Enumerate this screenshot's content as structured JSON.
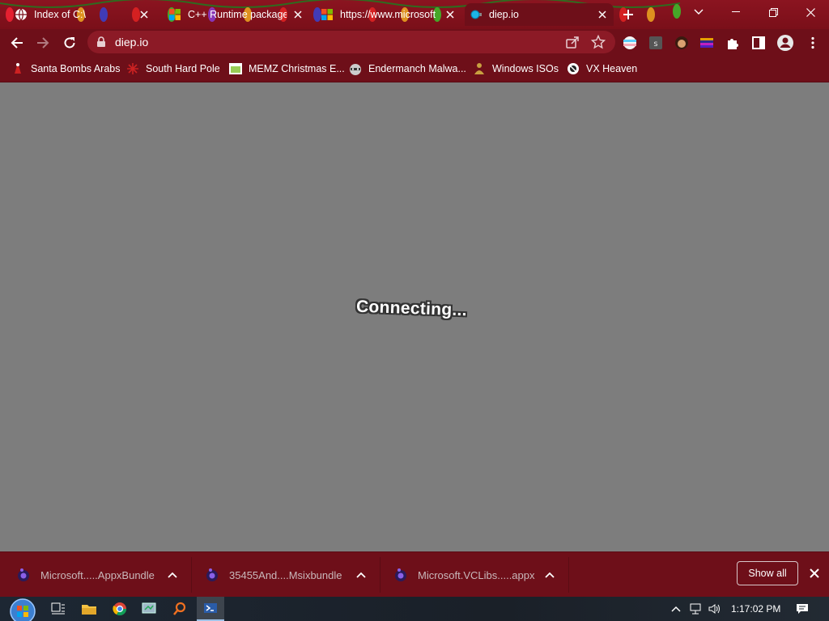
{
  "tabs": [
    {
      "title": "Index of C:\\",
      "favicon": "globe-icon"
    },
    {
      "title": "C++ Runtime package",
      "favicon": "microsoft-icon"
    },
    {
      "title": "https://www.microsoft",
      "favicon": "microsoft-icon"
    },
    {
      "title": "diep.io",
      "favicon": "diep-icon",
      "active": true
    }
  ],
  "address_bar": {
    "url": "diep.io"
  },
  "bookmarks": [
    {
      "label": "Santa Bombs Arabs",
      "icon": "santa-icon"
    },
    {
      "label": "South Hard Pole",
      "icon": "snowflake-icon"
    },
    {
      "label": "MEMZ Christmas E...",
      "icon": "memz-icon"
    },
    {
      "label": "Endermanch Malwa...",
      "icon": "raccoon-icon"
    },
    {
      "label": "Windows ISOs",
      "icon": "buddha-icon"
    },
    {
      "label": "VX Heaven",
      "icon": "vx-icon"
    }
  ],
  "page": {
    "status_text": "Connecting..."
  },
  "downloads": [
    {
      "name": "Microsoft.....AppxBundle"
    },
    {
      "name": "35455And....Msixbundle"
    },
    {
      "name": "Microsoft.VCLibs.....appx"
    }
  ],
  "download_shelf": {
    "show_all_label": "Show all"
  },
  "taskbar": {
    "time": "1:17:02 PM"
  },
  "colors": {
    "theme": "#6e0f19",
    "page_bg": "#7d7d7d"
  }
}
